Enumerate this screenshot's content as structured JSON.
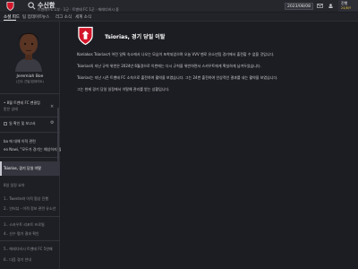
{
  "topbar": {
    "title": "수신함",
    "subtitle": "트벤테 FC 1부 · 1군 · 트벤테 FC 1군 · 에레디비시 중",
    "date": "2023/08/08",
    "continue_label": "진행",
    "continue_date": "24/8/Y"
  },
  "nav": {
    "tabs": [
      "소셜 피드",
      "팀 업데이트",
      "뉴스",
      "리그 소식",
      "세계 소식"
    ]
  },
  "sidebar": {
    "player_name": "Jeremiah Boe",
    "player_position": "(선수 선발/업데이트)",
    "filter_label": "• 8월 트벤테 FC 팬클럽",
    "filter_sub": "받은 상태",
    "report_item": "일 확인 및 보고서",
    "entries": [
      {
        "text": "ba 에 대해 이적 관련",
        "dim": false
      },
      {
        "text": "eo Nawi, \"모두가 경기는 예상하지 않아\"",
        "dim": false
      },
      {
        "text": "Tsiorias, 경기 당일 이탈",
        "dim": false
      },
      {
        "text": "8일 일정 요약",
        "dim": true
      },
      {
        "text": "1.. Twente와 이적 협상 진행",
        "dim": true
      },
      {
        "text": "2.. 인터뷰 - 이적 정보 관련 유소년",
        "dim": true
      },
      {
        "text": "3.. 스카우트 리포트 프로필",
        "dim": true
      },
      {
        "text": "4.. 선수 평가 결과 확인",
        "dim": true
      },
      {
        "text": "5.. 에레디비시 트벤테 FC 5연패",
        "dim": true
      },
      {
        "text": "6.. 다음 경기 안내",
        "dim": true
      }
    ]
  },
  "message": {
    "title": "Tsiorias, 경기 당일 이탈",
    "paragraphs": [
      "Konlakos Tsiorias가 어린 일찍 숙소에서 나오는 모습이 포착되었으며 오늘 VVV 벤로 유소년팀 경기에서 출전할 수 없을 것입니다.",
      "Tsiorias의 지난 규칙 위반은 2024년 6월경으로 이번에는 다시 규칙을 위반하면서 스카우트에게 확실하게 남겨두었습니다.",
      "Tsiorias는 지난 시즌 트벤테 FC 소속으로 출전하여 활약을 보였습니다. 그는 24번 출전하여 인상적인 결과를 내는 활약을 보였습니다.",
      "그는 현재 경기 당일 일정에서 이탈해 관리를 받는 상황입니다."
    ]
  },
  "colors": {
    "brand_red": "#d3162a",
    "background": "#1c1d22",
    "accent_gold": "#e6c040"
  }
}
